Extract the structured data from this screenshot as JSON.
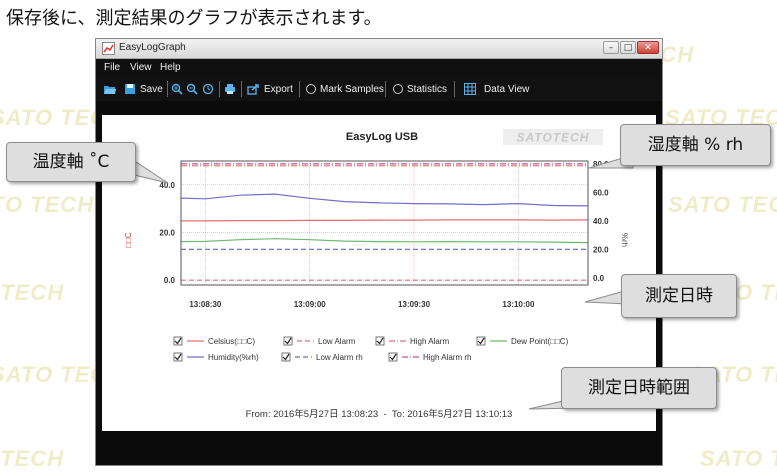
{
  "caption": "保存後に、測定結果のグラフが表示されます。",
  "watermark": "SATO TECH",
  "window": {
    "title": "EasyLogGraph",
    "menu": [
      "File",
      "View",
      "Help"
    ],
    "toolbar": {
      "save": "Save",
      "export": "Export",
      "mark_samples": "Mark Samples",
      "statistics": "Statistics",
      "data_view": "Data View"
    }
  },
  "chart_data": {
    "type": "line",
    "title": "EasyLog USB",
    "logo": "SATOTECH",
    "y_left": {
      "label": "□□C",
      "range": [
        -2,
        50
      ],
      "ticks": [
        "0.0",
        "20.0",
        "40.0"
      ]
    },
    "y_right": {
      "label": "%rh",
      "range": [
        -5,
        82
      ],
      "ticks": [
        "0.0",
        "20.0",
        "40.0",
        "60.0",
        "80.0"
      ]
    },
    "x": {
      "range": [
        "13:08:23",
        "13:10:20"
      ],
      "ticks": [
        "13:08:30",
        "13:09:00",
        "13:09:30",
        "13:10:00"
      ]
    },
    "x_seconds": [
      0,
      7,
      17,
      27,
      37,
      47,
      57,
      67,
      77,
      87,
      97,
      107,
      117
    ],
    "series": [
      {
        "name": "Celsius(□□C)",
        "axis": "left",
        "style": "solid",
        "color": "#e07070",
        "values": [
          24.9,
          24.9,
          25.0,
          25.0,
          25.1,
          25.1,
          25.2,
          25.2,
          25.3,
          25.3,
          25.3,
          25.2,
          25.3
        ]
      },
      {
        "name": "Low Alarm",
        "axis": "left",
        "style": "dashed",
        "color": "#e07070",
        "values": [
          0,
          0,
          0,
          0,
          0,
          0,
          0,
          0,
          0,
          0,
          0,
          0,
          0
        ]
      },
      {
        "name": "High Alarm",
        "axis": "left",
        "style": "dashdot",
        "color": "#e07070",
        "values": [
          48,
          48,
          48,
          48,
          48,
          48,
          48,
          48,
          48,
          48,
          48,
          48,
          48
        ]
      },
      {
        "name": "Dew Point(□□C)",
        "axis": "left",
        "style": "solid",
        "color": "#70b870",
        "values": [
          16.2,
          16.3,
          17.0,
          17.4,
          17.0,
          16.4,
          16.2,
          16.1,
          16.2,
          16.1,
          16.1,
          16.0,
          15.8
        ]
      },
      {
        "name": "Humidity(%rh)",
        "axis": "right",
        "style": "solid",
        "color": "#7070c8",
        "values": [
          56.0,
          55.5,
          58.0,
          58.8,
          55.8,
          53.5,
          52.6,
          52.1,
          51.9,
          51.4,
          52.1,
          50.8,
          50.5
        ]
      },
      {
        "name": "Low Alarm rh",
        "axis": "right",
        "style": "dashed",
        "color": "#7070c8",
        "values": [
          20,
          20,
          20,
          20,
          20,
          20,
          20,
          20,
          20,
          20,
          20,
          20,
          20
        ]
      },
      {
        "name": "High Alarm rh",
        "axis": "right",
        "style": "dashdot",
        "color": "#c050a0",
        "values": [
          80,
          80,
          80,
          80,
          80,
          80,
          80,
          80,
          80,
          80,
          80,
          80,
          80
        ]
      }
    ],
    "legend_checked": [
      true,
      true,
      true,
      true,
      true,
      true,
      true
    ],
    "legend_placement": "bottom",
    "grid": true,
    "range_text": "From: 2016年5月27日 13:08:23  -  To: 2016年5月27日 13:10:13"
  },
  "callouts": {
    "temp_axis": "温度軸 ˚C",
    "humidity_axis": "湿度軸 % rh",
    "datetime": "測定日時",
    "datetime_range": "測定日時範囲"
  }
}
